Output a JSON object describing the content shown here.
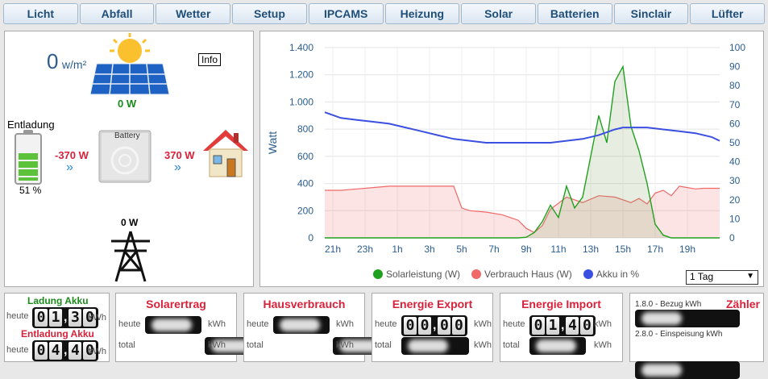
{
  "tabs": [
    "Licht",
    "Abfall",
    "Wetter",
    "Setup",
    "IPCAMS",
    "Heizung",
    "Solar",
    "Batterien",
    "Sinclair",
    "Lüfter"
  ],
  "flow": {
    "irradiance_value": "0",
    "irradiance_unit": "w/m²",
    "info_label": "Info",
    "solar_power": "0 W",
    "battery_state": "Entladung",
    "battery_percent": "51 %",
    "battery_percent_value": 51,
    "battery_power": "-370 W",
    "battery_label": "Battery",
    "house_power": "370 W",
    "grid_power": "0 W"
  },
  "chart_data": {
    "type": "line",
    "x_ticks": [
      "21h",
      "23h",
      "1h",
      "3h",
      "5h",
      "7h",
      "9h",
      "11h",
      "13h",
      "15h",
      "17h",
      "19h"
    ],
    "y_left_ticks": [
      "0",
      "200",
      "400",
      "600",
      "800",
      "1.000",
      "1.200",
      "1.400"
    ],
    "y_right_ticks": [
      "0",
      "10",
      "20",
      "30",
      "40",
      "50",
      "60",
      "70",
      "80",
      "90",
      "100"
    ],
    "ylabel": "Watt",
    "ylim_left": [
      0,
      1400
    ],
    "ylim_right": [
      0,
      100
    ],
    "xlim_hours_after_2030": [
      0,
      24.5
    ],
    "legend_position": "bottom",
    "series": [
      {
        "name": "Solarleistung (W)",
        "color": "#1fa11f",
        "x": [
          0,
          11.5,
          12,
          12.5,
          13,
          13.5,
          14,
          14.5,
          15,
          15.5,
          16,
          16.5,
          17,
          17.5,
          18,
          18.5,
          19,
          19.5,
          20,
          20.5,
          21,
          21.5,
          22,
          22.5,
          23,
          23.5,
          24,
          24.5
        ],
        "y": [
          0,
          0,
          0,
          5,
          40,
          120,
          240,
          150,
          380,
          220,
          300,
          600,
          900,
          700,
          1150,
          1260,
          820,
          640,
          400,
          100,
          20,
          0,
          0,
          0,
          0,
          0,
          0,
          0
        ]
      },
      {
        "name": "Verbrauch Haus (W)",
        "color": "#f06868",
        "x": [
          0,
          1,
          2,
          3,
          4,
          5,
          6,
          7,
          8,
          8.5,
          9,
          10,
          11,
          12,
          12.5,
          13,
          13.5,
          14,
          15,
          16,
          17,
          18,
          19,
          19.5,
          20,
          20.5,
          21,
          21.5,
          22,
          22.5,
          23,
          23.5,
          24,
          24.5
        ],
        "y": [
          350,
          350,
          360,
          370,
          380,
          380,
          380,
          380,
          380,
          220,
          200,
          190,
          170,
          130,
          70,
          40,
          90,
          210,
          300,
          260,
          310,
          300,
          260,
          290,
          250,
          330,
          350,
          310,
          380,
          370,
          360,
          365,
          365,
          365
        ]
      },
      {
        "name": "Akku in %",
        "color": "#3b4fe0",
        "x": [
          0,
          1,
          2,
          3,
          4,
          5,
          6,
          7,
          8,
          9,
          10,
          11,
          12,
          13,
          14,
          15,
          16,
          17,
          18,
          18.5,
          19,
          20,
          21,
          22,
          23,
          24,
          24.5
        ],
        "y": [
          66,
          63,
          62,
          61,
          60,
          58,
          56,
          54,
          52,
          51,
          50,
          50,
          50,
          50,
          50,
          51,
          52,
          54,
          57,
          58,
          58,
          58,
          57,
          56,
          55,
          53,
          51
        ]
      }
    ]
  },
  "range_select": "1 Tag",
  "ladung": {
    "title_charge": "Ladung Akku",
    "title_discharge": "Entladung Akku",
    "heute": "heute",
    "unit": "kWh",
    "charge_digits": [
      "0",
      "1",
      "3",
      "0"
    ],
    "discharge_digits": [
      "0",
      "4",
      "4",
      "0"
    ]
  },
  "boxes": [
    {
      "title": "Solarertrag",
      "heute": "heute",
      "total": "total",
      "unit": "kWh"
    },
    {
      "title": "Hausverbrauch",
      "heute": "heute",
      "total": "total",
      "unit": "kWh"
    },
    {
      "title": "Energie Export",
      "heute": "heute",
      "total": "total",
      "unit": "kWh",
      "digits": [
        "0",
        "0",
        "0",
        "0"
      ]
    },
    {
      "title": "Energie Import",
      "heute": "heute",
      "total": "total",
      "unit": "kWh",
      "digits": [
        "0",
        "1",
        "4",
        "0"
      ]
    }
  ],
  "zaehler": {
    "title": "Zähler",
    "bezug": "1.8.0 - Bezug kWh",
    "einspeisung": "2.8.0 - Einspeisung kWh"
  }
}
